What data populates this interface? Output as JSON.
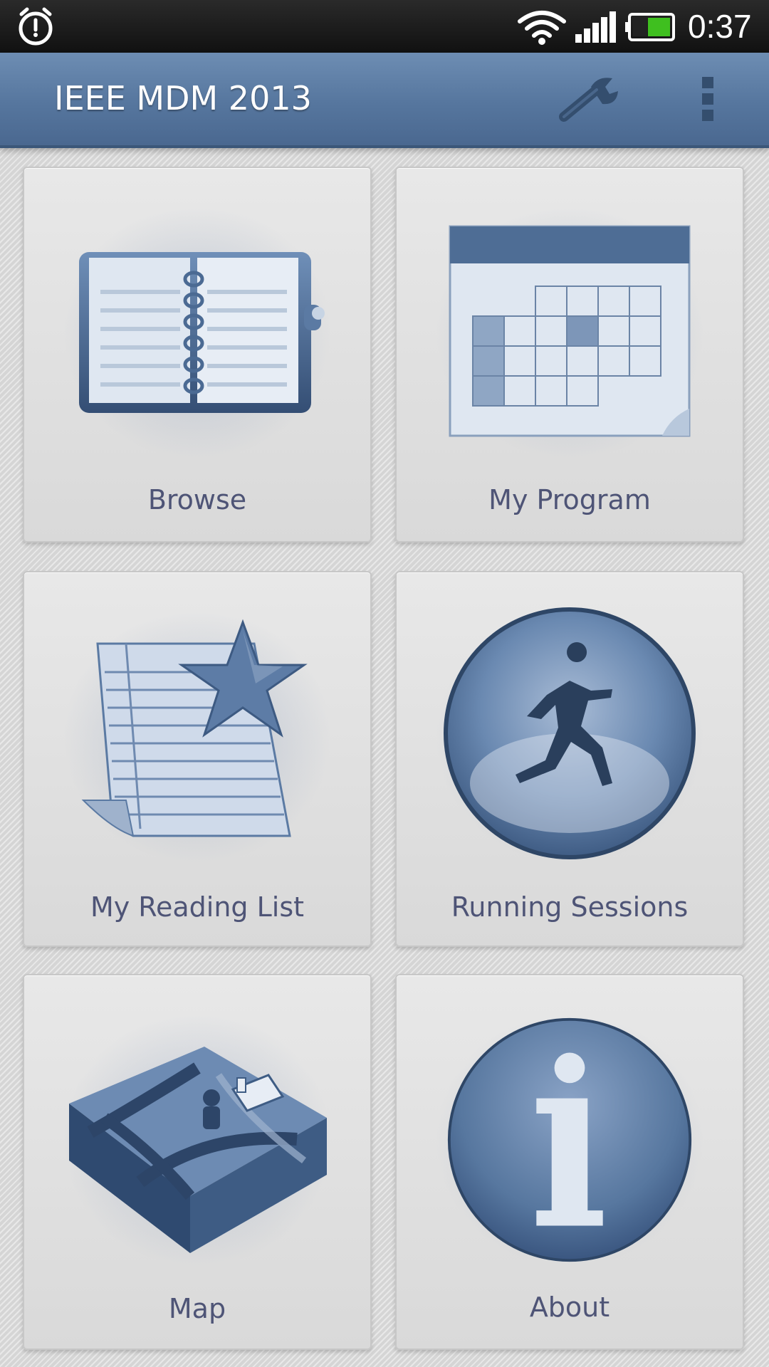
{
  "status_bar": {
    "time": "0:37",
    "icons": [
      "alarm-icon",
      "wifi-icon",
      "signal-icon",
      "battery-icon"
    ],
    "battery_color": "#3fbf1f"
  },
  "app_bar": {
    "title": "IEEE MDM 2013",
    "actions": [
      "wrench-icon",
      "overflow-menu-icon"
    ],
    "color": "#5a7aa3"
  },
  "tiles": [
    {
      "label": "Browse",
      "icon": "book-icon"
    },
    {
      "label": "My Program",
      "icon": "calendar-icon"
    },
    {
      "label": "My Reading List",
      "icon": "reading-list-star-icon"
    },
    {
      "label": "Running Sessions",
      "icon": "runner-icon"
    },
    {
      "label": "Map",
      "icon": "map-icon"
    },
    {
      "label": "About",
      "icon": "info-icon"
    }
  ],
  "colors": {
    "accent": "#4f6f98",
    "label": "#4e5476"
  }
}
